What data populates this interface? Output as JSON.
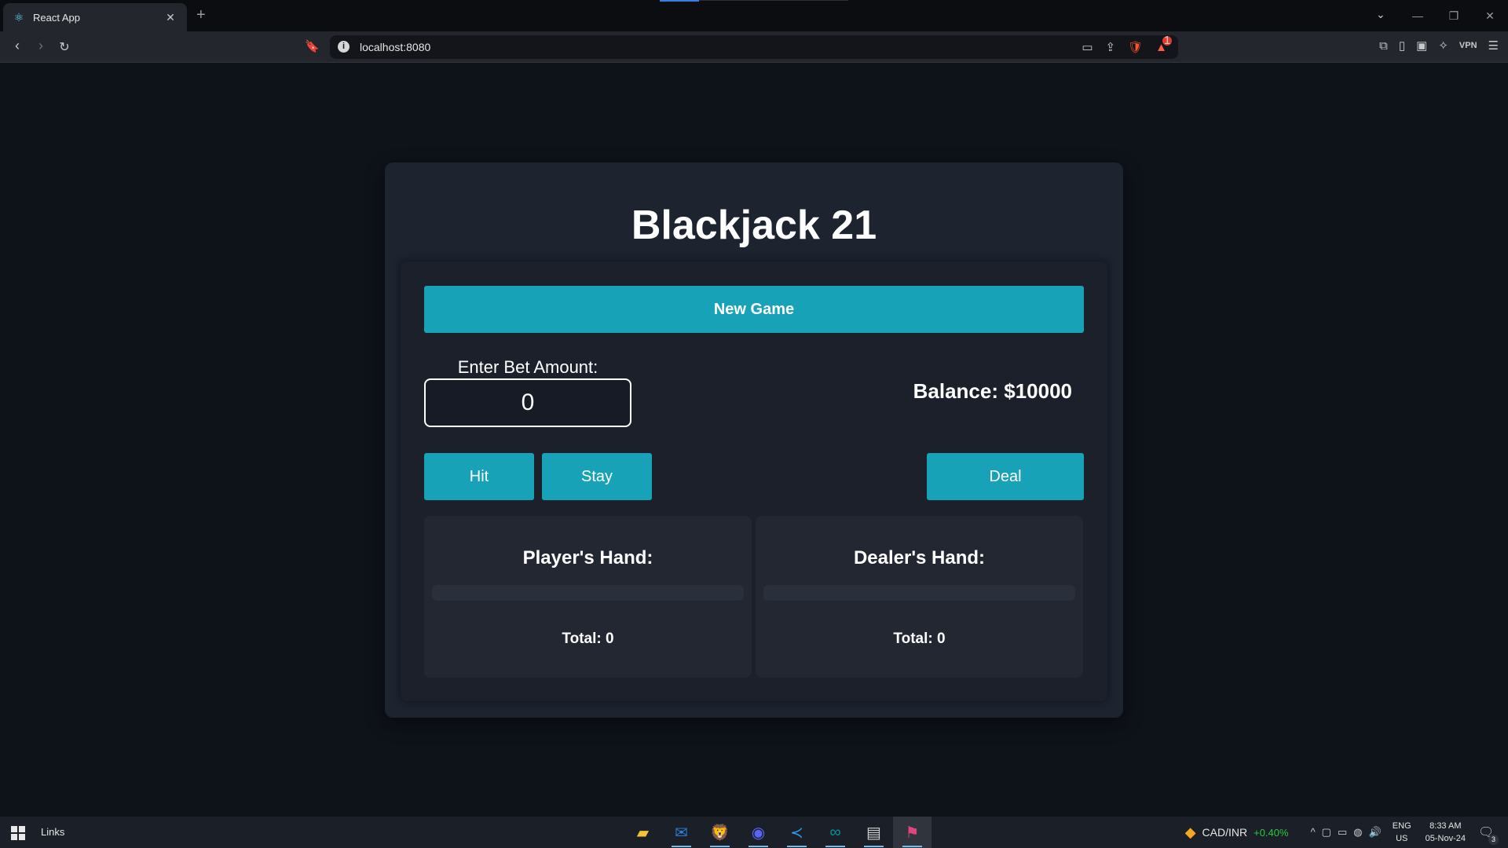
{
  "browser": {
    "tab_title": "React App",
    "tab_close": "✕",
    "new_tab": "+",
    "url": "localhost:8080",
    "vpn_label": "VPN",
    "rewards_badge": "1"
  },
  "game": {
    "title": "Blackjack 21",
    "new_game_label": "New Game",
    "bet_label": "Enter Bet Amount:",
    "bet_value": "0",
    "balance_text": "Balance: $10000",
    "hit_label": "Hit",
    "stay_label": "Stay",
    "deal_label": "Deal",
    "player_hand_title": "Player's Hand:",
    "player_total": "Total: 0",
    "dealer_hand_title": "Dealer's Hand:",
    "dealer_total": "Total: 0",
    "accent_color": "#17a2b8"
  },
  "taskbar": {
    "links_label": "Links",
    "ticker_name": "CAD/INR",
    "ticker_change": "+0.40%",
    "lang_line1": "ENG",
    "lang_line2": "US",
    "time": "8:33 AM",
    "date": "05-Nov-24",
    "notification_count": "3",
    "apps": [
      "file-explorer",
      "outlook",
      "brave",
      "discord",
      "vscode",
      "arduino",
      "terminal",
      "app-pinned"
    ]
  }
}
